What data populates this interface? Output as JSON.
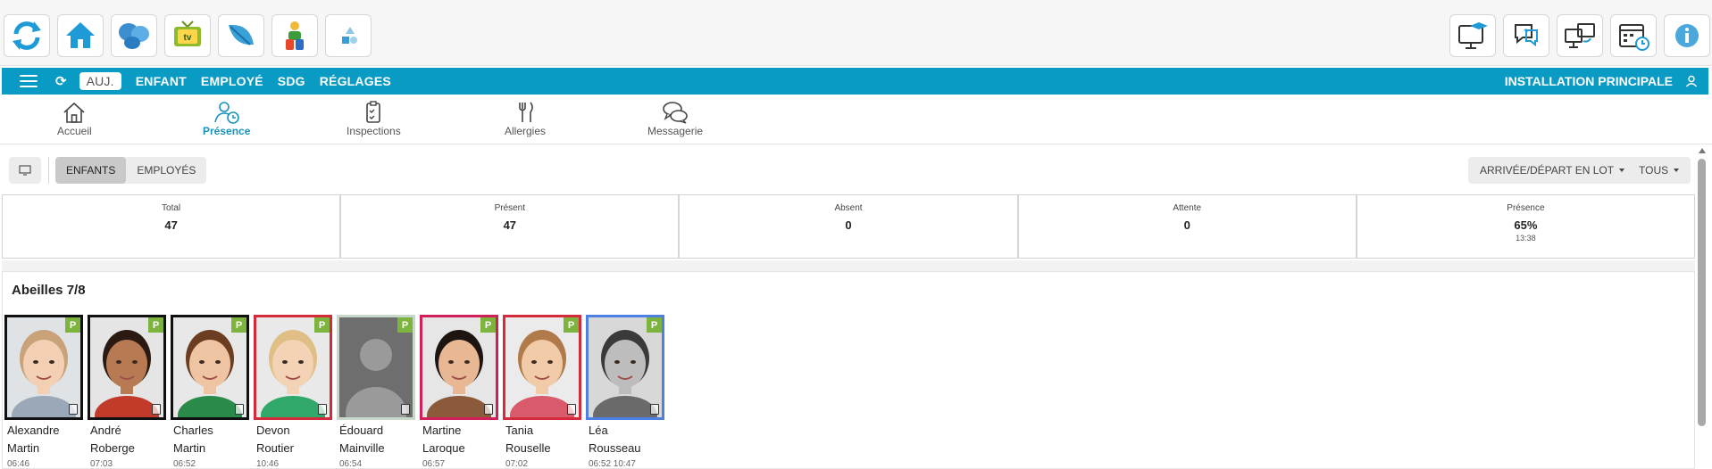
{
  "toolbar": {
    "left_buttons": [
      "refresh-icon",
      "home-icon",
      "butterfly-icon",
      "tv-icon",
      "leaf-icon",
      "child-toy-icon",
      "shapes-icon"
    ],
    "tv_label": "tv",
    "right_buttons": [
      "monitor-graduation-icon",
      "help-chat-icon",
      "screen-sync-icon",
      "calendar-clock-icon",
      "info-icon"
    ]
  },
  "navbar": {
    "items": [
      {
        "label": "AUJ.",
        "active": true
      },
      {
        "label": "ENFANT"
      },
      {
        "label": "EMPLOYÉ"
      },
      {
        "label": "SDG"
      },
      {
        "label": "RÉGLAGES"
      }
    ],
    "site": "INSTALLATION PRINCIPALE",
    "color": "#0a9bc4"
  },
  "subtabs": [
    {
      "label": "Accueil",
      "icon": "home-outline-icon"
    },
    {
      "label": "Présence",
      "icon": "user-clock-icon",
      "active": true
    },
    {
      "label": "Inspections",
      "icon": "clipboard-check-icon"
    },
    {
      "label": "Allergies",
      "icon": "fork-knife-icon"
    },
    {
      "label": "Messagerie",
      "icon": "chat-bubbles-icon"
    }
  ],
  "filters": {
    "segments": [
      "ENFANTS",
      "EMPLOYÉS"
    ],
    "batch": "ARRIVÉE/DÉPART EN LOT",
    "scope": "TOUS"
  },
  "stats": [
    {
      "label": "Total",
      "value": "47"
    },
    {
      "label": "Présent",
      "value": "47"
    },
    {
      "label": "Absent",
      "value": "0"
    },
    {
      "label": "Attente",
      "value": "0"
    },
    {
      "label": "Présence",
      "value": "65%",
      "sub": "13:38"
    }
  ],
  "group": {
    "title": "Abeilles 7/8",
    "children": [
      {
        "first": "Alexandre",
        "last": "Martin",
        "time": "06:46",
        "border": "#111111",
        "badge": "P"
      },
      {
        "first": "André",
        "last": "Roberge",
        "time": "07:03",
        "border": "#111111",
        "badge": "P"
      },
      {
        "first": "Charles",
        "last": "Martin",
        "time": "06:52",
        "border": "#111111",
        "badge": "P"
      },
      {
        "first": "Devon",
        "last": "Routier",
        "time": "10:46",
        "border": "#d42a3a",
        "badge": "P"
      },
      {
        "first": "Édouard",
        "last": "Mainville",
        "time": "06:54",
        "border": "#c9d9c9",
        "badge": "P"
      },
      {
        "first": "Martine",
        "last": "Laroque",
        "time": "06:57",
        "border": "#d21f5a",
        "badge": "P"
      },
      {
        "first": "Tania",
        "last": "Rouselle",
        "time": "07:02",
        "border": "#d42a3a",
        "badge": "P"
      },
      {
        "first": "Léa",
        "last": "Rousseau",
        "time": "06:52 10:47",
        "border": "#4f7fe0",
        "badge": "P"
      }
    ]
  }
}
